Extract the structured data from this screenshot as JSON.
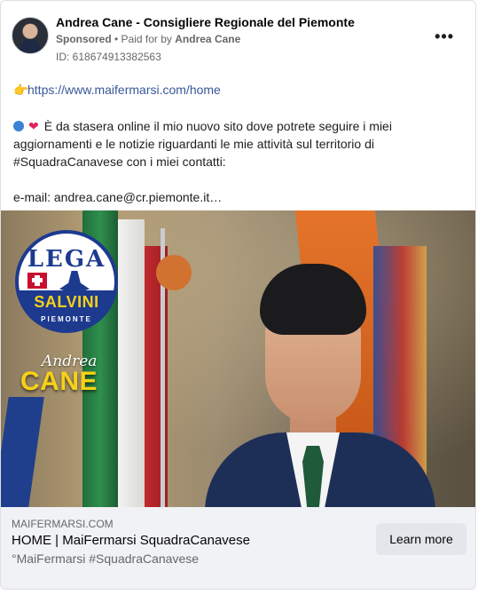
{
  "post": {
    "page_name": "Andrea Cane - Consigliere Regionale del Piemonte",
    "sponsored": "Sponsored",
    "paid_prefix": "• Paid for by",
    "payer": "Andrea Cane",
    "ad_id": "ID: 618674913382563",
    "more_icon": "more-dots-icon"
  },
  "body": {
    "hand_emoji": "👉",
    "link_text": "https://www.maifermarsi.com/home",
    "heart_emoji": "❤",
    "main_text": "È da stasera online il mio nuovo sito dove potrete seguire i miei aggiornamenti e le notizie riguardanti le mie attività sul territorio di #SquadraCanavese con i miei contatti:",
    "email_line": "e-mail: andrea.cane@cr.piemonte.it…"
  },
  "media": {
    "logo": {
      "lega": "LEGA",
      "salvini": "SALVINI",
      "piemonte": "PIEMONTE"
    },
    "signature_first": "Andrea",
    "signature_last": "CANE"
  },
  "footer": {
    "domain": "MAIFERMARSI.COM",
    "headline": "HOME | MaiFermarsi SquadraCanavese",
    "description": "°MaiFermarsi #SquadraCanavese",
    "cta_label": "Learn more"
  }
}
